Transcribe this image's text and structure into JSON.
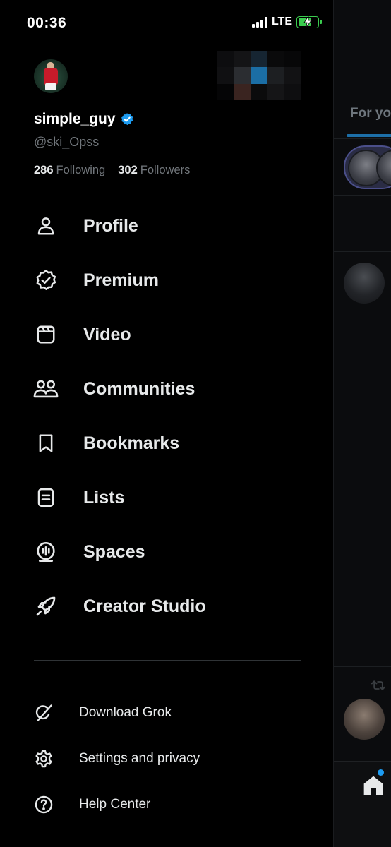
{
  "status_bar": {
    "time": "00:36",
    "network": "LTE",
    "battery_charging": true,
    "battery_color": "#3acb4e"
  },
  "profile": {
    "display_name": "simple_guy",
    "verified": true,
    "verified_color": "#1d9bf0",
    "handle": "@ski_Opss",
    "following_count": "286",
    "following_label": "Following",
    "followers_count": "302",
    "followers_label": "Followers"
  },
  "menu": {
    "primary": [
      {
        "label": "Profile",
        "icon": "person-icon"
      },
      {
        "label": "Premium",
        "icon": "verified-badge-icon"
      },
      {
        "label": "Video",
        "icon": "video-icon"
      },
      {
        "label": "Communities",
        "icon": "communities-icon"
      },
      {
        "label": "Bookmarks",
        "icon": "bookmark-icon"
      },
      {
        "label": "Lists",
        "icon": "lists-icon"
      },
      {
        "label": "Spaces",
        "icon": "spaces-icon"
      },
      {
        "label": "Creator Studio",
        "icon": "rocket-icon"
      }
    ],
    "secondary": [
      {
        "label": "Download Grok",
        "icon": "grok-icon"
      },
      {
        "label": "Settings and privacy",
        "icon": "gear-icon"
      },
      {
        "label": "Help Center",
        "icon": "help-icon"
      }
    ]
  },
  "background_timeline": {
    "tab_label": "For you",
    "accent_color": "#1d9bf0"
  }
}
